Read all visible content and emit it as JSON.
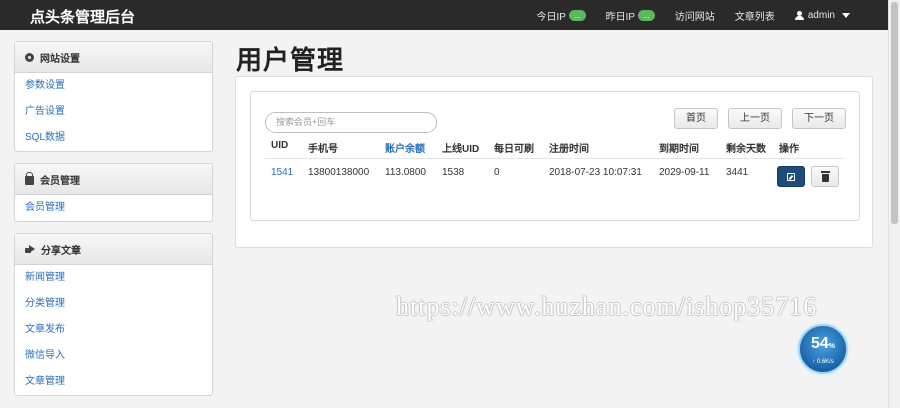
{
  "topbar": {
    "brand": "点头条管理后台",
    "nav": [
      {
        "label": "今日IP",
        "badge": "..."
      },
      {
        "label": "昨日IP",
        "badge": "..."
      },
      {
        "label": "访问网站"
      },
      {
        "label": "文章列表"
      }
    ],
    "user": "admin"
  },
  "sidebar": [
    {
      "title": "网站设置",
      "icon": "gear-icon",
      "items": [
        "参数设置",
        "广告设置",
        "SQL数据"
      ]
    },
    {
      "title": "会员管理",
      "icon": "lock-icon",
      "items": [
        "会员管理"
      ]
    },
    {
      "title": "分享文章",
      "icon": "share-icon",
      "items": [
        "新闻管理",
        "分类管理",
        "文章发布",
        "微信导入",
        "文章管理"
      ]
    }
  ],
  "main": {
    "title": "用户管理",
    "search_placeholder": "搜索会员+回车",
    "pager": [
      "首页",
      "上一页",
      "下一页"
    ],
    "columns": [
      "UID",
      "手机号",
      "账户余额",
      "上线UID",
      "每日可刷",
      "注册时间",
      "到期时间",
      "剩余天数",
      "操作"
    ],
    "rows": [
      [
        "1541",
        "13800138000",
        "113.0800",
        "1538",
        "0",
        "2018-07-23 10:07:31",
        "2029-09-11",
        "3441"
      ]
    ]
  },
  "watermark": "https://www.huzhan.com/ishop35716",
  "netspeed": {
    "percent": "54",
    "unit": "%",
    "speed": "0.6K/s"
  },
  "colors": {
    "accent": "#2a6ebb",
    "topbar": "#2a2a2a",
    "badge": "#5cb85c",
    "edit_button": "#1f4b7a"
  }
}
